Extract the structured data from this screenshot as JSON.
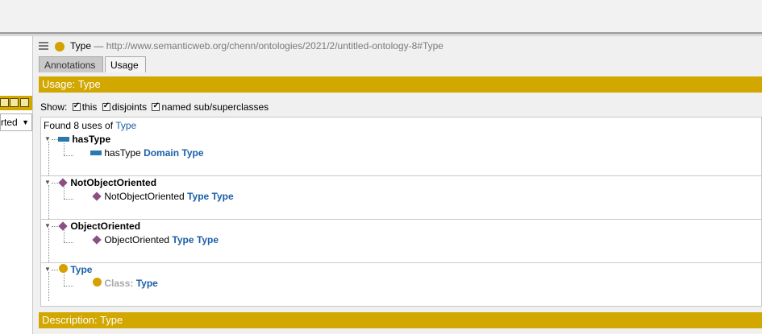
{
  "header": {
    "title": "Type",
    "separator": "—",
    "iri": "http://www.semanticweb.org/chenn/ontologies/2021/2/untitled-ontology-8#Type"
  },
  "left_panel": {
    "select_value": "rted"
  },
  "tabs": [
    {
      "label": "Annotations",
      "active": false
    },
    {
      "label": "Usage",
      "active": true
    }
  ],
  "usage_bar": {
    "title": "Usage: Type"
  },
  "show": {
    "label": "Show:",
    "options": [
      {
        "label": "this",
        "checked": true
      },
      {
        "label": "disjoints",
        "checked": true
      },
      {
        "label": "named sub/superclasses",
        "checked": true
      }
    ]
  },
  "results": {
    "found_prefix": "Found 8 uses of",
    "found_entity": "Type",
    "groups": [
      {
        "kind": "object-property",
        "label": "hasType",
        "child": {
          "kind": "object-property",
          "subject": "hasType",
          "keyword": "Domain",
          "object": "Type"
        }
      },
      {
        "kind": "individual",
        "label": "NotObjectOriented",
        "child": {
          "kind": "individual",
          "subject": "NotObjectOriented",
          "keyword": "Type",
          "object": "Type"
        }
      },
      {
        "kind": "individual",
        "label": "ObjectOriented",
        "child": {
          "kind": "individual",
          "subject": "ObjectOriented",
          "keyword": "Type",
          "object": "Type"
        }
      },
      {
        "kind": "class",
        "label": "Type",
        "child": {
          "kind": "class",
          "subject": "Class:",
          "keyword": "",
          "object": "Type"
        }
      }
    ]
  },
  "description_bar": {
    "title": "Description: Type"
  },
  "colors": {
    "accent_yellow": "#d1a700",
    "link_blue": "#1a5fa8",
    "individual_purple": "#8c4f82",
    "property_blue": "#2a78b0",
    "class_gold": "#d4a100"
  }
}
